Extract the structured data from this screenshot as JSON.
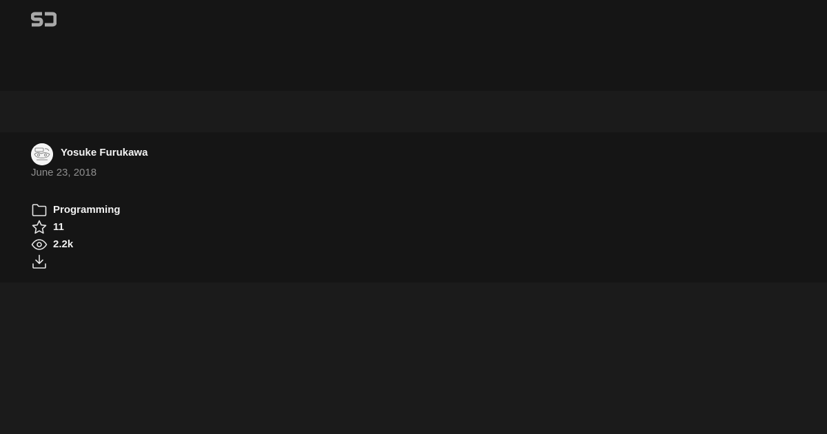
{
  "header": {
    "logo_icon": "sj-logo"
  },
  "post": {
    "author": "Yosuke Furukawa",
    "date": "June 23, 2018"
  },
  "meta": {
    "category": {
      "icon": "folder-icon",
      "label": "Programming"
    },
    "stars": {
      "icon": "star-icon",
      "label": "11"
    },
    "views": {
      "icon": "eye-icon",
      "label": "2.2k"
    },
    "download": {
      "icon": "download-icon"
    }
  },
  "colors": {
    "header_bg": "#151515",
    "page_bg": "#1b1b1b",
    "text": "#f2f2f2",
    "muted_text": "#8e8e8e",
    "logo": "#a8a8a8"
  }
}
